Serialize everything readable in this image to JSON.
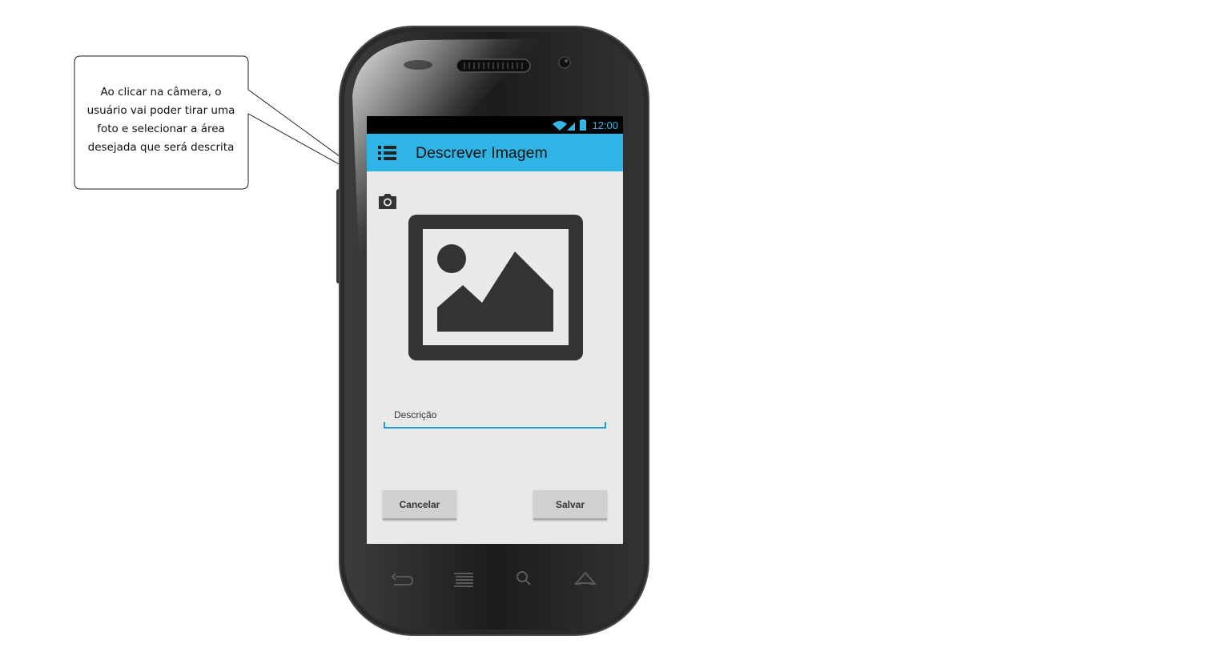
{
  "callout": {
    "lines": [
      "Ao clicar na câmera, o",
      "usuário vai poder tirar uma",
      "foto e selecionar a área",
      "desejada que será descrita"
    ]
  },
  "statusbar": {
    "time": "12:00"
  },
  "appbar": {
    "title": "Descrever Imagem",
    "menu_icon": "list-menu-icon"
  },
  "main": {
    "camera_icon": "camera-icon",
    "image_icon": "image-placeholder-icon",
    "description_placeholder": "Descrição",
    "cancel_label": "Cancelar",
    "save_label": "Salvar"
  },
  "navbar": {
    "icons": [
      "back-icon",
      "recent-apps-icon",
      "search-icon",
      "home-icon"
    ]
  },
  "colors": {
    "accent": "#2eb5e6",
    "status_text": "#33b5e5",
    "screen_bg": "#e9e9e9",
    "icon_dark": "#333333"
  }
}
